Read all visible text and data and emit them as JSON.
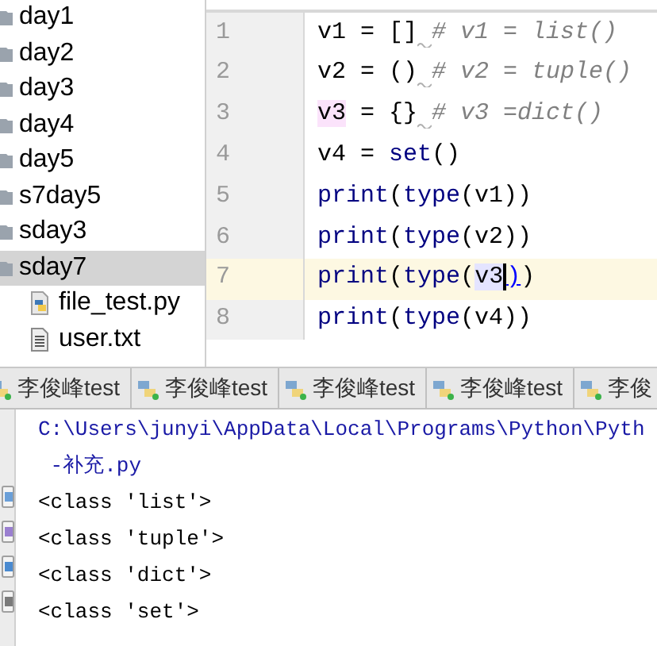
{
  "project_tree": {
    "items": [
      {
        "name": "day1",
        "kind": "folder",
        "selected": false
      },
      {
        "name": "day2",
        "kind": "folder",
        "selected": false
      },
      {
        "name": "day3",
        "kind": "folder",
        "selected": false
      },
      {
        "name": "day4",
        "kind": "folder",
        "selected": false
      },
      {
        "name": "day5",
        "kind": "folder",
        "selected": false
      },
      {
        "name": "s7day5",
        "kind": "folder",
        "selected": false
      },
      {
        "name": "sday3",
        "kind": "folder",
        "selected": false
      },
      {
        "name": "sday7",
        "kind": "folder",
        "selected": true,
        "children": [
          {
            "name": "file_test.py",
            "kind": "python",
            "selected": false
          },
          {
            "name": "user.txt",
            "kind": "text",
            "selected": false
          }
        ]
      }
    ]
  },
  "editor": {
    "lines": [
      {
        "number": "1",
        "current": false,
        "tokens": [
          {
            "text": "v1 = []",
            "kind": "plain"
          },
          {
            "text": "# v1 = list()",
            "kind": "warned-comment"
          }
        ]
      },
      {
        "number": "2",
        "current": false,
        "tokens": [
          {
            "text": "v2 = ()",
            "kind": "plain"
          },
          {
            "text": "# v2 = tuple()",
            "kind": "warned-comment"
          }
        ]
      },
      {
        "number": "3",
        "current": false,
        "tokens": [
          {
            "text": "v3",
            "kind": "marked"
          },
          {
            "text": " = {}",
            "kind": "plain"
          },
          {
            "text": "# v3 =dict()",
            "kind": "warned-comment"
          }
        ]
      },
      {
        "number": "4",
        "current": false,
        "tokens": [
          {
            "text": "v4 = ",
            "kind": "plain"
          },
          {
            "text": "set",
            "kind": "builtin"
          },
          {
            "text": "()",
            "kind": "plain"
          }
        ]
      },
      {
        "number": "5",
        "current": false,
        "tokens": [
          {
            "text": "print",
            "kind": "builtin"
          },
          {
            "text": "(",
            "kind": "plain"
          },
          {
            "text": "type",
            "kind": "builtin"
          },
          {
            "text": "(v1))",
            "kind": "plain"
          }
        ]
      },
      {
        "number": "6",
        "current": false,
        "tokens": [
          {
            "text": "print",
            "kind": "builtin"
          },
          {
            "text": "(",
            "kind": "plain"
          },
          {
            "text": "type",
            "kind": "builtin"
          },
          {
            "text": "(v2))",
            "kind": "plain"
          }
        ]
      },
      {
        "number": "7",
        "current": true,
        "tokens": [
          {
            "text": "print",
            "kind": "builtin"
          },
          {
            "text": "(",
            "kind": "plain"
          },
          {
            "text": "type",
            "kind": "builtin"
          },
          {
            "text": "(",
            "kind": "plain"
          },
          {
            "text": "v3",
            "kind": "occurrence"
          },
          {
            "text": ")",
            "kind": "brace"
          },
          {
            "text": ")",
            "kind": "plain"
          }
        ]
      },
      {
        "number": "8",
        "current": false,
        "tokens": [
          {
            "text": "print",
            "kind": "builtin"
          },
          {
            "text": "(",
            "kind": "plain"
          },
          {
            "text": "type",
            "kind": "builtin"
          },
          {
            "text": "(v4))",
            "kind": "plain"
          }
        ]
      }
    ]
  },
  "run_tabs": [
    {
      "label": "李俊峰test"
    },
    {
      "label": "李俊峰test"
    },
    {
      "label": "李俊峰test"
    },
    {
      "label": "李俊峰test"
    },
    {
      "label": "李俊"
    }
  ],
  "console": {
    "lines": [
      {
        "text": "C:\\Users\\junyi\\AppData\\Local\\Programs\\Python\\Pyth",
        "kind": "command"
      },
      {
        "text": " -补充.py",
        "kind": "command"
      },
      {
        "text": "<class 'list'>",
        "kind": "output"
      },
      {
        "text": "<class 'tuple'>",
        "kind": "output"
      },
      {
        "text": "<class 'dict'>",
        "kind": "output"
      },
      {
        "text": "<class 'set'>",
        "kind": "output"
      }
    ]
  }
}
